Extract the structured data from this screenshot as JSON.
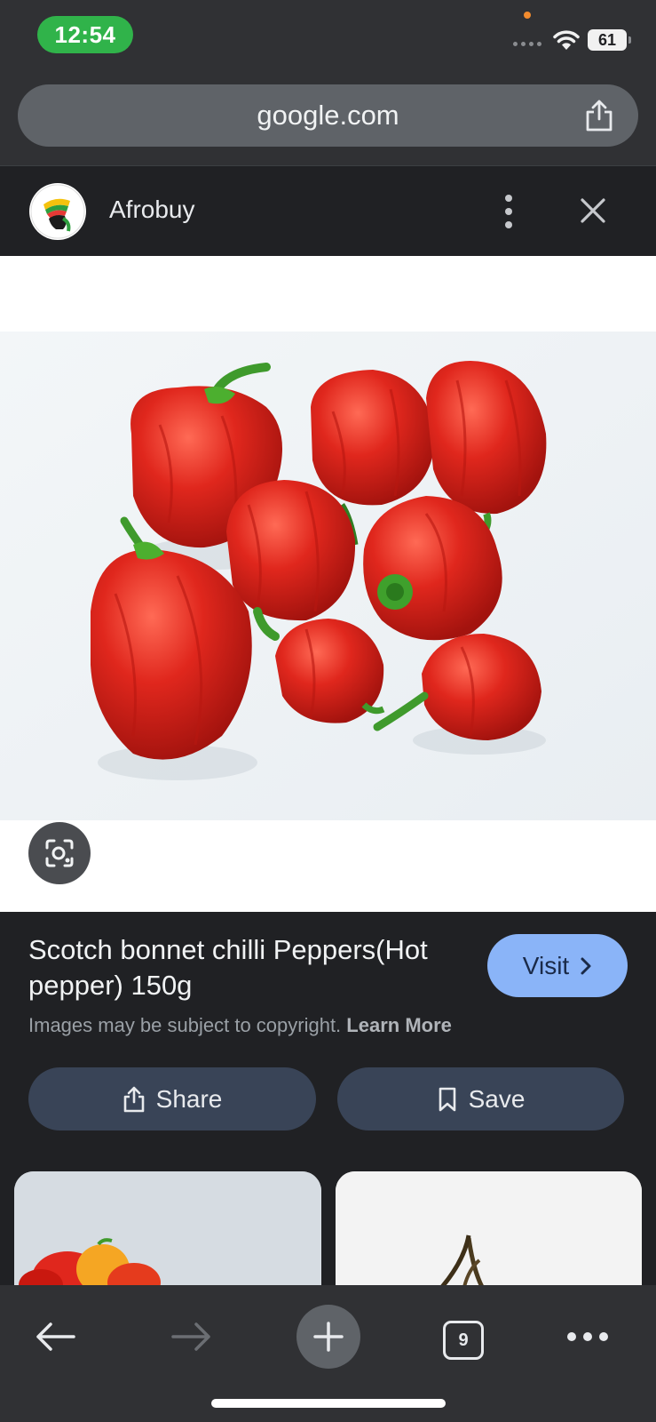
{
  "status_bar": {
    "time": "12:54",
    "battery": "61"
  },
  "browser": {
    "url": "google.com"
  },
  "site": {
    "name": "Afrobuy"
  },
  "result": {
    "title": "Scotch bonnet chilli Peppers(Hot pepper) 150g",
    "visit_label": "Visit",
    "copyright_text": "Images may be subject to copyright.",
    "learn_more": "Learn More",
    "share_label": "Share",
    "save_label": "Save"
  },
  "toolbar": {
    "tab_count": "9"
  },
  "colors": {
    "time_pill": "#30b34a",
    "visit_button": "#8ab4f8",
    "action_button": "#394457",
    "panel_bg": "#202124",
    "chrome_bg": "#303134",
    "pepper_red": "#e0271d"
  },
  "icons": [
    "wifi-icon",
    "battery-icon",
    "share-icon",
    "kebab-menu-icon",
    "close-icon",
    "lens-icon",
    "chevron-right-icon",
    "bookmark-icon",
    "back-arrow-icon",
    "forward-arrow-icon",
    "plus-icon",
    "tab-count-icon",
    "more-icon"
  ]
}
